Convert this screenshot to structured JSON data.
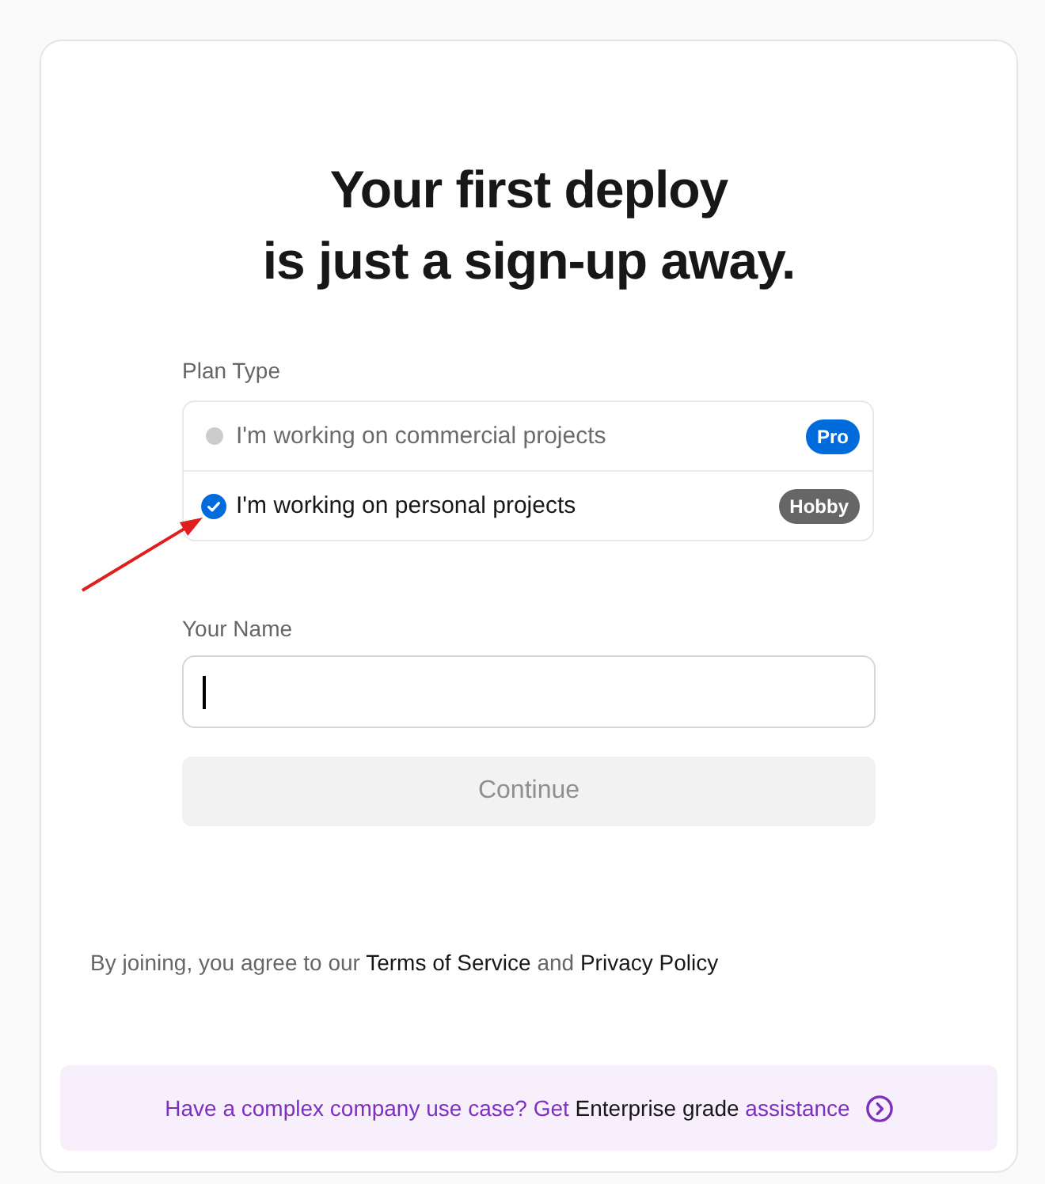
{
  "heading_lines": [
    "Your first deploy",
    "is just a sign-up away."
  ],
  "plan_type": {
    "label": "Plan Type",
    "options": [
      {
        "text": "I'm working on commercial projects",
        "badge": "Pro",
        "color": "#006bdb",
        "selected": false
      },
      {
        "text": "I'm working on personal projects",
        "badge": "Hobby",
        "color": "#666666",
        "selected": true
      }
    ]
  },
  "name_field": {
    "label": "Your Name",
    "focused": true
  },
  "continue_button": {
    "label": "Continue",
    "disabled": true
  },
  "terms": [
    {
      "kind": "text",
      "text": "By joining, you agree to our "
    },
    {
      "kind": "link",
      "text": "Terms of Service"
    },
    {
      "kind": "text",
      "text": " and "
    },
    {
      "kind": "link",
      "text": "Privacy Policy"
    }
  ],
  "enterprise_banner": {
    "text": "Have a complex company use case? Get **Enterprise grade** assistance"
  }
}
